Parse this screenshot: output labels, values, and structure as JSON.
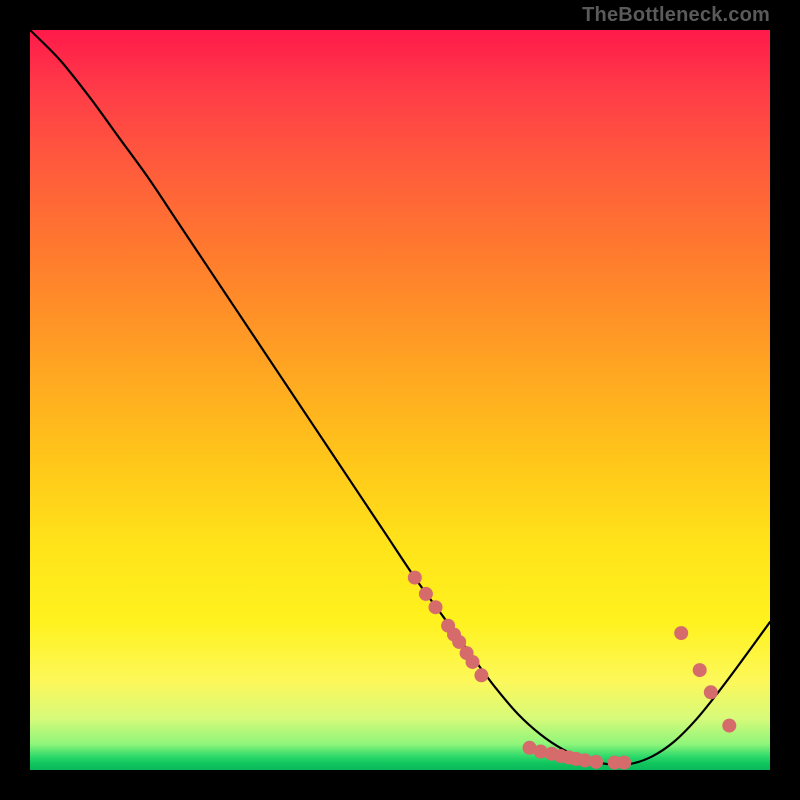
{
  "watermark": "TheBottleneck.com",
  "chart_data": {
    "type": "line",
    "title": "",
    "xlabel": "",
    "ylabel": "",
    "xlim": [
      0,
      100
    ],
    "ylim": [
      0,
      100
    ],
    "grid": false,
    "legend": false,
    "annotations": [],
    "series": [
      {
        "name": "curve",
        "x": [
          0,
          4,
          8,
          12,
          16,
          20,
          24,
          28,
          32,
          36,
          40,
          44,
          48,
          52,
          56,
          60,
          63,
          66,
          69,
          72,
          75,
          78,
          81,
          84,
          87,
          90,
          93,
          96,
          100
        ],
        "y": [
          100,
          96,
          91,
          85.5,
          80,
          74,
          68,
          62,
          56,
          50,
          44,
          38,
          32,
          26,
          20.5,
          15,
          11,
          7.5,
          4.8,
          2.8,
          1.5,
          0.8,
          0.8,
          1.8,
          3.8,
          6.8,
          10.5,
          14.5,
          20
        ],
        "color": "#000000"
      }
    ],
    "scatter": {
      "name": "markers",
      "color": "#d66b6b",
      "radius_px": 7,
      "points": [
        {
          "x": 52.0,
          "y": 26.0
        },
        {
          "x": 53.5,
          "y": 23.8
        },
        {
          "x": 54.8,
          "y": 22.0
        },
        {
          "x": 56.5,
          "y": 19.5
        },
        {
          "x": 57.3,
          "y": 18.3
        },
        {
          "x": 58.0,
          "y": 17.3
        },
        {
          "x": 59.0,
          "y": 15.8
        },
        {
          "x": 59.8,
          "y": 14.6
        },
        {
          "x": 61.0,
          "y": 12.8
        },
        {
          "x": 67.5,
          "y": 3.0
        },
        {
          "x": 69.0,
          "y": 2.5
        },
        {
          "x": 70.5,
          "y": 2.2
        },
        {
          "x": 71.7,
          "y": 1.9
        },
        {
          "x": 72.8,
          "y": 1.7
        },
        {
          "x": 73.8,
          "y": 1.5
        },
        {
          "x": 75.0,
          "y": 1.3
        },
        {
          "x": 76.5,
          "y": 1.1
        },
        {
          "x": 79.0,
          "y": 1.0
        },
        {
          "x": 80.3,
          "y": 1.0
        },
        {
          "x": 88.0,
          "y": 18.5
        },
        {
          "x": 90.5,
          "y": 13.5
        },
        {
          "x": 92.0,
          "y": 10.5
        },
        {
          "x": 94.5,
          "y": 6.0
        }
      ]
    }
  }
}
